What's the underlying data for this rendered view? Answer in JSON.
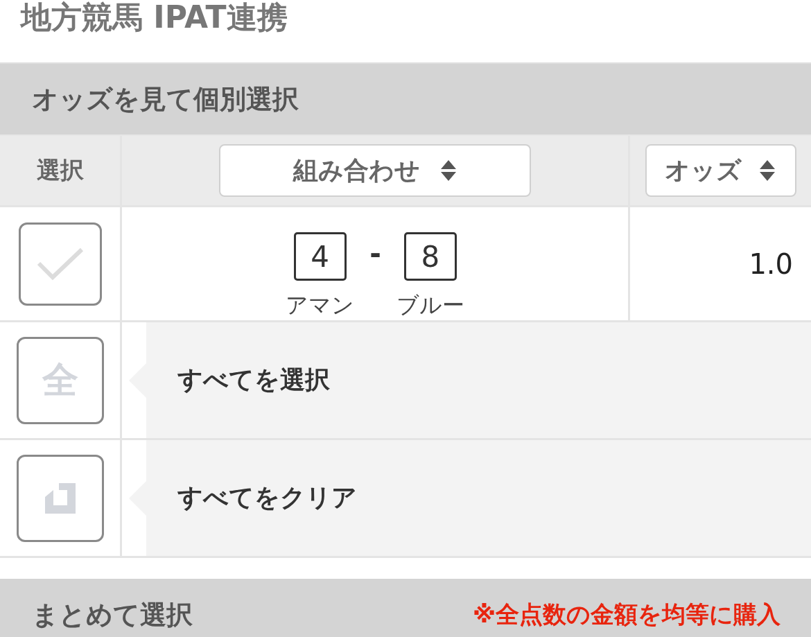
{
  "page_title": "地方競馬 IPAT連携",
  "section": {
    "title": "オッズを見て個別選択"
  },
  "columns": [
    {
      "label": "選択",
      "kind": "plain"
    },
    {
      "label": "組み合わせ",
      "kind": "sort"
    },
    {
      "label": "オッズ",
      "kind": "sort"
    }
  ],
  "rows": [
    {
      "checked": false,
      "numbers": [
        {
          "number": "4",
          "name": "アマン"
        },
        {
          "number": "8",
          "name": "ブルー"
        }
      ],
      "separator": "-",
      "odds": "1.0"
    }
  ],
  "actions": [
    {
      "kind": "all",
      "icon_text": "全",
      "label": "すべてを選択"
    },
    {
      "kind": "clear",
      "label": "すべてをクリア"
    }
  ],
  "bottom_section": {
    "title": "まとめて選択",
    "note": "※全点数の金額を均等に購入"
  }
}
